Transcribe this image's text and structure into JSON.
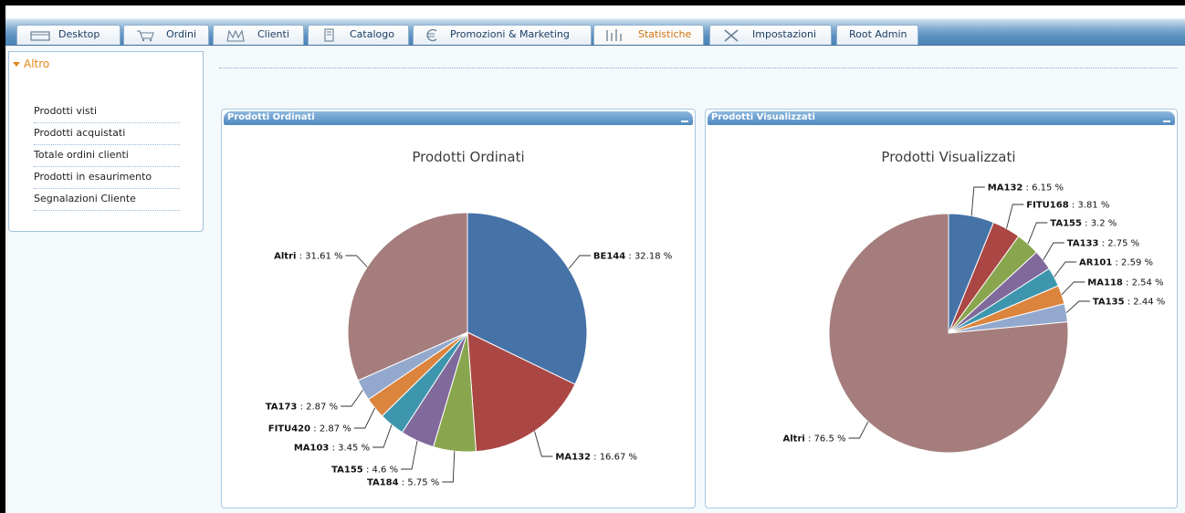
{
  "tabs": [
    {
      "label": "Desktop",
      "icon": "desktop-icon"
    },
    {
      "label": "Ordini",
      "icon": "cart-icon"
    },
    {
      "label": "Clienti",
      "icon": "clients-icon"
    },
    {
      "label": "Catalogo",
      "icon": "catalog-icon"
    },
    {
      "label": "Promozioni & Marketing",
      "icon": "euro-icon"
    },
    {
      "label": "Statistiche",
      "icon": "stats-icon",
      "active": true
    },
    {
      "label": "Impostazioni",
      "icon": "tools-icon"
    },
    {
      "label": "Root Admin",
      "icon": ""
    }
  ],
  "sidebar": {
    "title": "Altro",
    "items": [
      {
        "label": "Prodotti visti"
      },
      {
        "label": "Prodotti acquistati"
      },
      {
        "label": "Totale ordini clienti"
      },
      {
        "label": "Prodotti in esaurimento"
      },
      {
        "label": "Segnalazioni Cliente"
      }
    ]
  },
  "panels": [
    {
      "header": "Prodotti Ordinati"
    },
    {
      "header": "Prodotti Visualizzati"
    }
  ],
  "colors": {
    "accent": "#e0861a",
    "tab_text": "#1c3d63",
    "panel_header": "#4f88bf"
  },
  "chart_data": [
    {
      "type": "pie",
      "title": "Prodotti Ordinati",
      "slices": [
        {
          "label": "BE144",
          "value": 32.18,
          "color": "#4572a7"
        },
        {
          "label": "MA132",
          "value": 16.67,
          "color": "#aa4643"
        },
        {
          "label": "TA184",
          "value": 5.75,
          "color": "#89a54e"
        },
        {
          "label": "TA155",
          "value": 4.6,
          "color": "#80699b"
        },
        {
          "label": "MA103",
          "value": 3.45,
          "color": "#3d96ae"
        },
        {
          "label": "FITU420",
          "value": 2.87,
          "color": "#db843d"
        },
        {
          "label": "TA173",
          "value": 2.87,
          "color": "#92a8cd"
        },
        {
          "label": "Altri",
          "value": 31.61,
          "color": "#a47d7c"
        }
      ]
    },
    {
      "type": "pie",
      "title": "Prodotti Visualizzati",
      "slices": [
        {
          "label": "MA132",
          "value": 6.15,
          "color": "#4572a7"
        },
        {
          "label": "FITU168",
          "value": 3.81,
          "color": "#aa4643"
        },
        {
          "label": "TA155",
          "value": 3.2,
          "color": "#89a54e"
        },
        {
          "label": "TA133",
          "value": 2.75,
          "color": "#80699b"
        },
        {
          "label": "AR101",
          "value": 2.59,
          "color": "#3d96ae"
        },
        {
          "label": "MA118",
          "value": 2.54,
          "color": "#db843d"
        },
        {
          "label": "TA135",
          "value": 2.44,
          "color": "#92a8cd"
        },
        {
          "label": "Altri",
          "value": 76.5,
          "color": "#a47d7c"
        }
      ]
    }
  ]
}
